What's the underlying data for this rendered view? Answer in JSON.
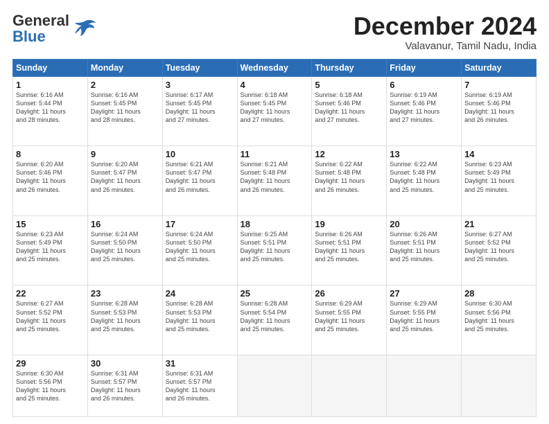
{
  "logo": {
    "line1": "General",
    "line2": "Blue"
  },
  "title": "December 2024",
  "subtitle": "Valavanur, Tamil Nadu, India",
  "header_days": [
    "Sunday",
    "Monday",
    "Tuesday",
    "Wednesday",
    "Thursday",
    "Friday",
    "Saturday"
  ],
  "weeks": [
    [
      {
        "day": "1",
        "info": "Sunrise: 6:16 AM\nSunset: 5:44 PM\nDaylight: 11 hours\nand 28 minutes."
      },
      {
        "day": "2",
        "info": "Sunrise: 6:16 AM\nSunset: 5:45 PM\nDaylight: 11 hours\nand 28 minutes."
      },
      {
        "day": "3",
        "info": "Sunrise: 6:17 AM\nSunset: 5:45 PM\nDaylight: 11 hours\nand 27 minutes."
      },
      {
        "day": "4",
        "info": "Sunrise: 6:18 AM\nSunset: 5:45 PM\nDaylight: 11 hours\nand 27 minutes."
      },
      {
        "day": "5",
        "info": "Sunrise: 6:18 AM\nSunset: 5:46 PM\nDaylight: 11 hours\nand 27 minutes."
      },
      {
        "day": "6",
        "info": "Sunrise: 6:19 AM\nSunset: 5:46 PM\nDaylight: 11 hours\nand 27 minutes."
      },
      {
        "day": "7",
        "info": "Sunrise: 6:19 AM\nSunset: 5:46 PM\nDaylight: 11 hours\nand 26 minutes."
      }
    ],
    [
      {
        "day": "8",
        "info": "Sunrise: 6:20 AM\nSunset: 5:46 PM\nDaylight: 11 hours\nand 26 minutes."
      },
      {
        "day": "9",
        "info": "Sunrise: 6:20 AM\nSunset: 5:47 PM\nDaylight: 11 hours\nand 26 minutes."
      },
      {
        "day": "10",
        "info": "Sunrise: 6:21 AM\nSunset: 5:47 PM\nDaylight: 11 hours\nand 26 minutes."
      },
      {
        "day": "11",
        "info": "Sunrise: 6:21 AM\nSunset: 5:48 PM\nDaylight: 11 hours\nand 26 minutes."
      },
      {
        "day": "12",
        "info": "Sunrise: 6:22 AM\nSunset: 5:48 PM\nDaylight: 11 hours\nand 26 minutes."
      },
      {
        "day": "13",
        "info": "Sunrise: 6:22 AM\nSunset: 5:48 PM\nDaylight: 11 hours\nand 25 minutes."
      },
      {
        "day": "14",
        "info": "Sunrise: 6:23 AM\nSunset: 5:49 PM\nDaylight: 11 hours\nand 25 minutes."
      }
    ],
    [
      {
        "day": "15",
        "info": "Sunrise: 6:23 AM\nSunset: 5:49 PM\nDaylight: 11 hours\nand 25 minutes."
      },
      {
        "day": "16",
        "info": "Sunrise: 6:24 AM\nSunset: 5:50 PM\nDaylight: 11 hours\nand 25 minutes."
      },
      {
        "day": "17",
        "info": "Sunrise: 6:24 AM\nSunset: 5:50 PM\nDaylight: 11 hours\nand 25 minutes."
      },
      {
        "day": "18",
        "info": "Sunrise: 6:25 AM\nSunset: 5:51 PM\nDaylight: 11 hours\nand 25 minutes."
      },
      {
        "day": "19",
        "info": "Sunrise: 6:26 AM\nSunset: 5:51 PM\nDaylight: 11 hours\nand 25 minutes."
      },
      {
        "day": "20",
        "info": "Sunrise: 6:26 AM\nSunset: 5:51 PM\nDaylight: 11 hours\nand 25 minutes."
      },
      {
        "day": "21",
        "info": "Sunrise: 6:27 AM\nSunset: 5:52 PM\nDaylight: 11 hours\nand 25 minutes."
      }
    ],
    [
      {
        "day": "22",
        "info": "Sunrise: 6:27 AM\nSunset: 5:52 PM\nDaylight: 11 hours\nand 25 minutes."
      },
      {
        "day": "23",
        "info": "Sunrise: 6:28 AM\nSunset: 5:53 PM\nDaylight: 11 hours\nand 25 minutes."
      },
      {
        "day": "24",
        "info": "Sunrise: 6:28 AM\nSunset: 5:53 PM\nDaylight: 11 hours\nand 25 minutes."
      },
      {
        "day": "25",
        "info": "Sunrise: 6:28 AM\nSunset: 5:54 PM\nDaylight: 11 hours\nand 25 minutes."
      },
      {
        "day": "26",
        "info": "Sunrise: 6:29 AM\nSunset: 5:55 PM\nDaylight: 11 hours\nand 25 minutes."
      },
      {
        "day": "27",
        "info": "Sunrise: 6:29 AM\nSunset: 5:55 PM\nDaylight: 11 hours\nand 25 minutes."
      },
      {
        "day": "28",
        "info": "Sunrise: 6:30 AM\nSunset: 5:56 PM\nDaylight: 11 hours\nand 25 minutes."
      }
    ],
    [
      {
        "day": "29",
        "info": "Sunrise: 6:30 AM\nSunset: 5:56 PM\nDaylight: 11 hours\nand 25 minutes."
      },
      {
        "day": "30",
        "info": "Sunrise: 6:31 AM\nSunset: 5:57 PM\nDaylight: 11 hours\nand 26 minutes."
      },
      {
        "day": "31",
        "info": "Sunrise: 6:31 AM\nSunset: 5:57 PM\nDaylight: 11 hours\nand 26 minutes."
      },
      {
        "day": "",
        "info": ""
      },
      {
        "day": "",
        "info": ""
      },
      {
        "day": "",
        "info": ""
      },
      {
        "day": "",
        "info": ""
      }
    ]
  ]
}
